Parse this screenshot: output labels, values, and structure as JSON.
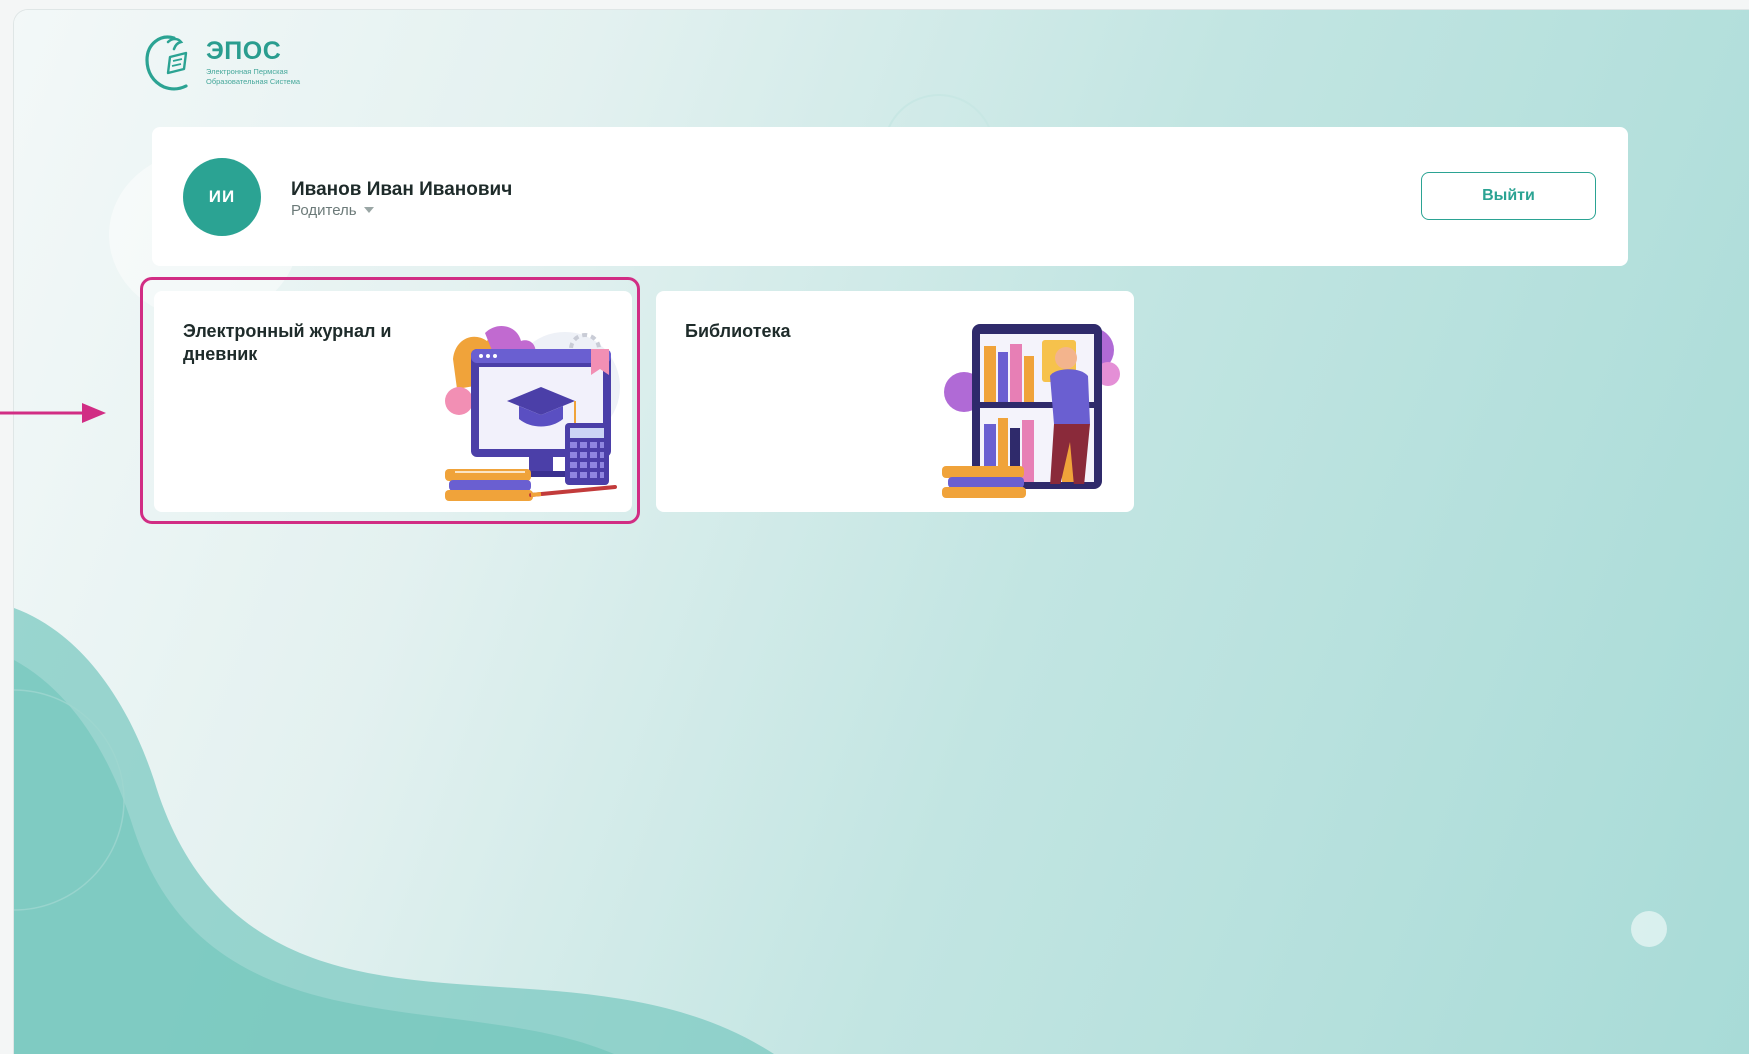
{
  "logo": {
    "title": "ЭПОС",
    "subtitle_line1": "Электронная Пермская",
    "subtitle_line2": "Образовательная Система"
  },
  "user": {
    "initials": "ИИ",
    "name": "Иванов Иван Иванович",
    "role": "Родитель",
    "logout_label": "Выйти"
  },
  "cards": [
    {
      "title": "Электронный журнал и дневник",
      "icon": "graduation-monitor-illustration",
      "highlighted": true
    },
    {
      "title": "Библиотека",
      "icon": "bookshelf-illustration",
      "highlighted": false
    }
  ],
  "colors": {
    "accent": "#2ba393",
    "highlight": "#d12d84",
    "background": "#c2e5e2"
  }
}
